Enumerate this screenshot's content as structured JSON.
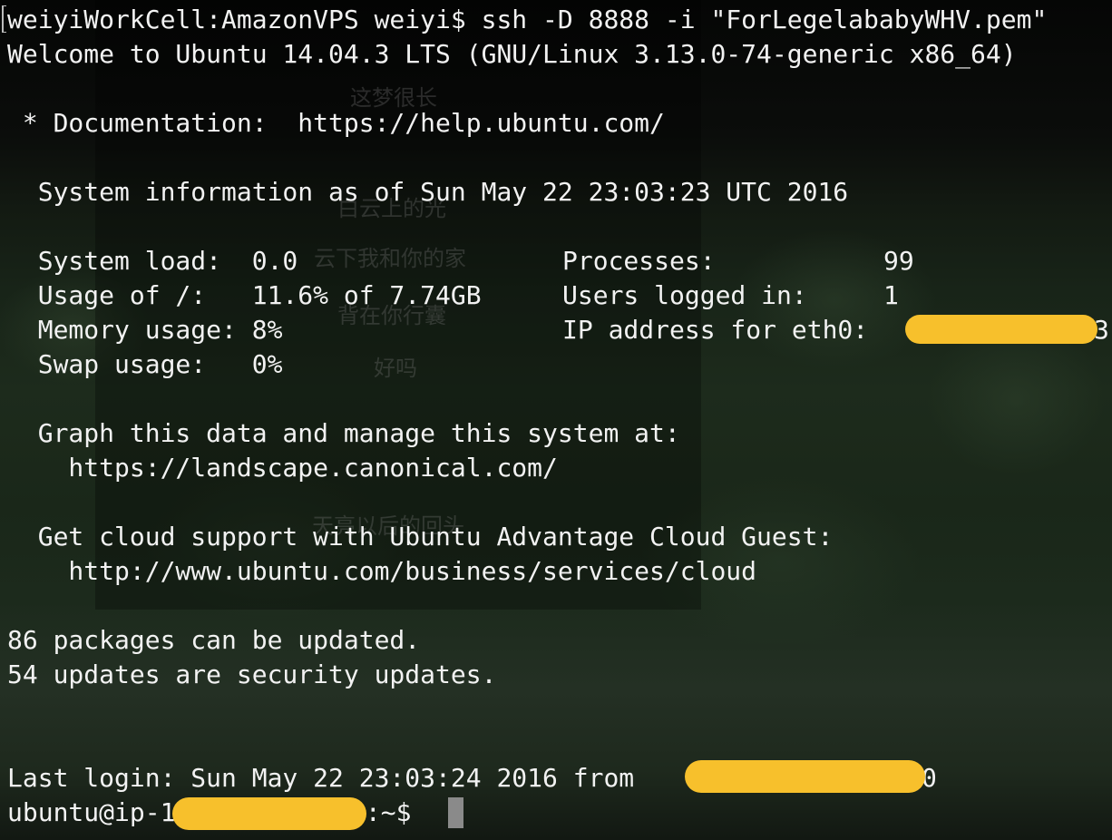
{
  "prompt_local": "weiyiWorkCell:AmazonVPS weiyi$ ssh -D 8888 -i \"ForLegelababyWHV.pem\"",
  "welcome": "Welcome to Ubuntu 14.04.3 LTS (GNU/Linux 3.13.0-74-generic x86_64)",
  "documentation": " * Documentation:  https://help.ubuntu.com/",
  "sysinfo_header": "  System information as of Sun May 22 23:03:23 UTC 2016",
  "stats_left": [
    "  System load:  0.0",
    "  Usage of /:   11.6% of 7.74GB",
    "  Memory usage: 8%",
    "  Swap usage:   0%"
  ],
  "stats_right": [
    "Processes:           99",
    "Users logged in:     1",
    "IP address for eth0: "
  ],
  "ip_suffix": "3",
  "graph_line": "  Graph this data and manage this system at:",
  "graph_url": "    https://landscape.canonical.com/",
  "cloud_line": "  Get cloud support with Ubuntu Advantage Cloud Guest:",
  "cloud_url": "    http://www.ubuntu.com/business/services/cloud",
  "packages_line": "86 packages can be updated.",
  "security_line": "54 updates are security updates.",
  "last_login_prefix": "Last login: Sun May 22 23:03:24 2016 from ",
  "last_login_suffix": "0",
  "remote_prompt_prefix": "ubuntu@ip-1",
  "remote_prompt_suffix": "3:~$ ",
  "background_lyrics": [
    "这梦很长",
    "白云上的光",
    "云下我和你的家",
    "背在你行囊",
    "好吗",
    "天亮以后的回头"
  ],
  "colors": {
    "text": "#f2f2f2",
    "redaction": "#f7c02c",
    "cursor": "#8a8a8a"
  }
}
